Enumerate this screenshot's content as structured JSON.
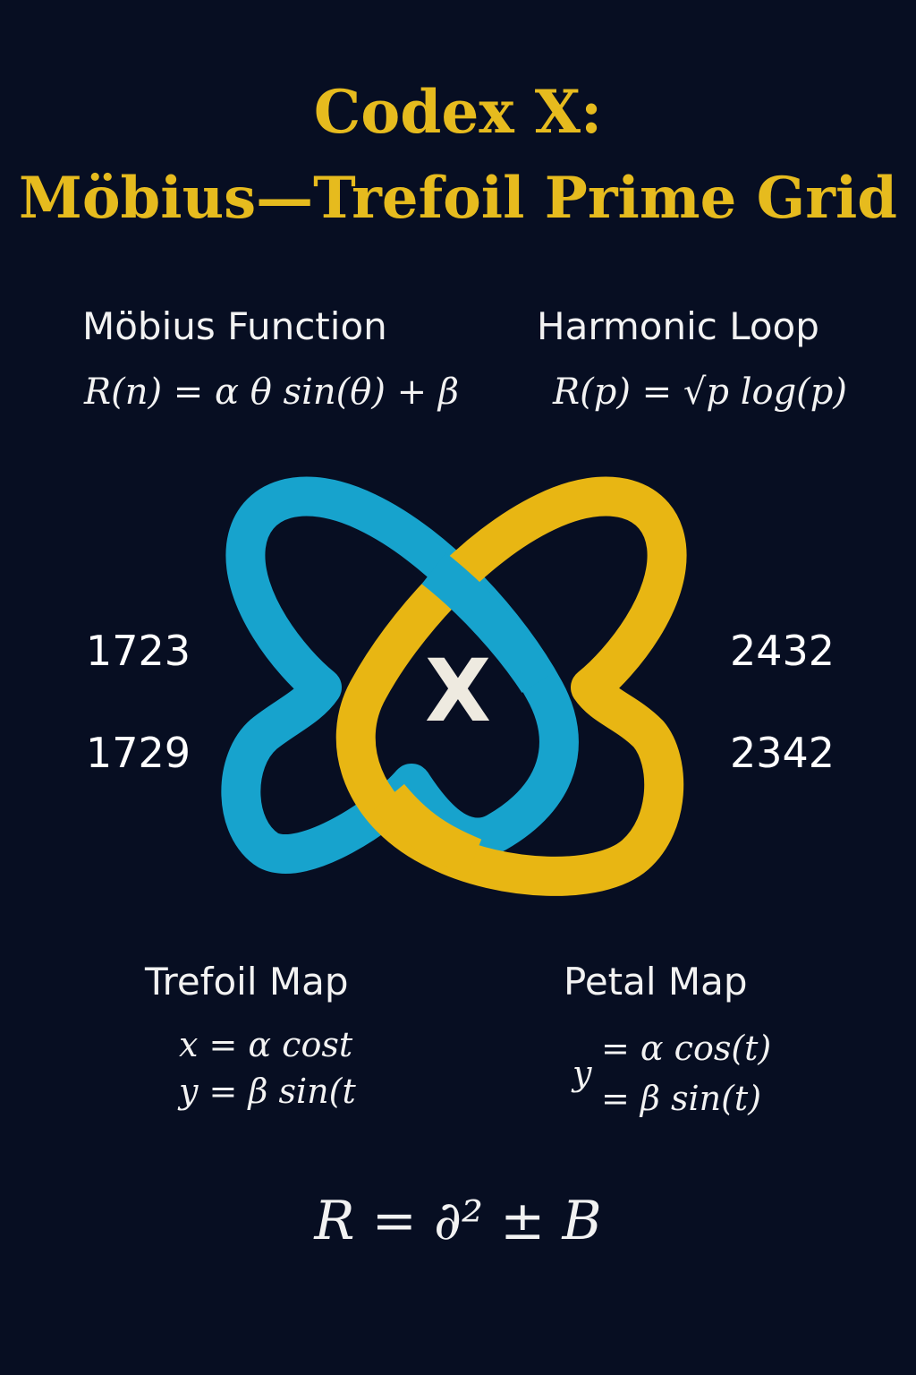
{
  "title": {
    "line1": "Codex X:",
    "line2": "Möbius—Trefoil Prime Grid"
  },
  "sections": {
    "mobius": {
      "heading": "Möbius Function",
      "formula": "R(n) = α θ sin(θ) + β"
    },
    "harmonic": {
      "heading": "Harmonic Loop",
      "formula": "R(p) = √p log(p)"
    },
    "trefoil": {
      "heading": "Trefoil Map",
      "formula_line1": "x = α cost",
      "formula_line2": "y = β sin(t"
    },
    "petal": {
      "heading": "Petal Map",
      "formula_y": "y",
      "formula_line1": "= α cos(t)",
      "formula_line2": "= β sin(t)"
    }
  },
  "numbers": {
    "left": [
      "1723",
      "1729"
    ],
    "right": [
      "2432",
      "2342"
    ]
  },
  "emblem": {
    "center_letter": "X",
    "colors": {
      "blue_loop": "#17a3cd",
      "gold_loop": "#e8b613",
      "center_letter": "#eeeae0"
    }
  },
  "final_formula": "R = ∂² ± B",
  "colors": {
    "background": "#070e22",
    "title": "#e6bb1e",
    "text": "#f2f2f2"
  }
}
